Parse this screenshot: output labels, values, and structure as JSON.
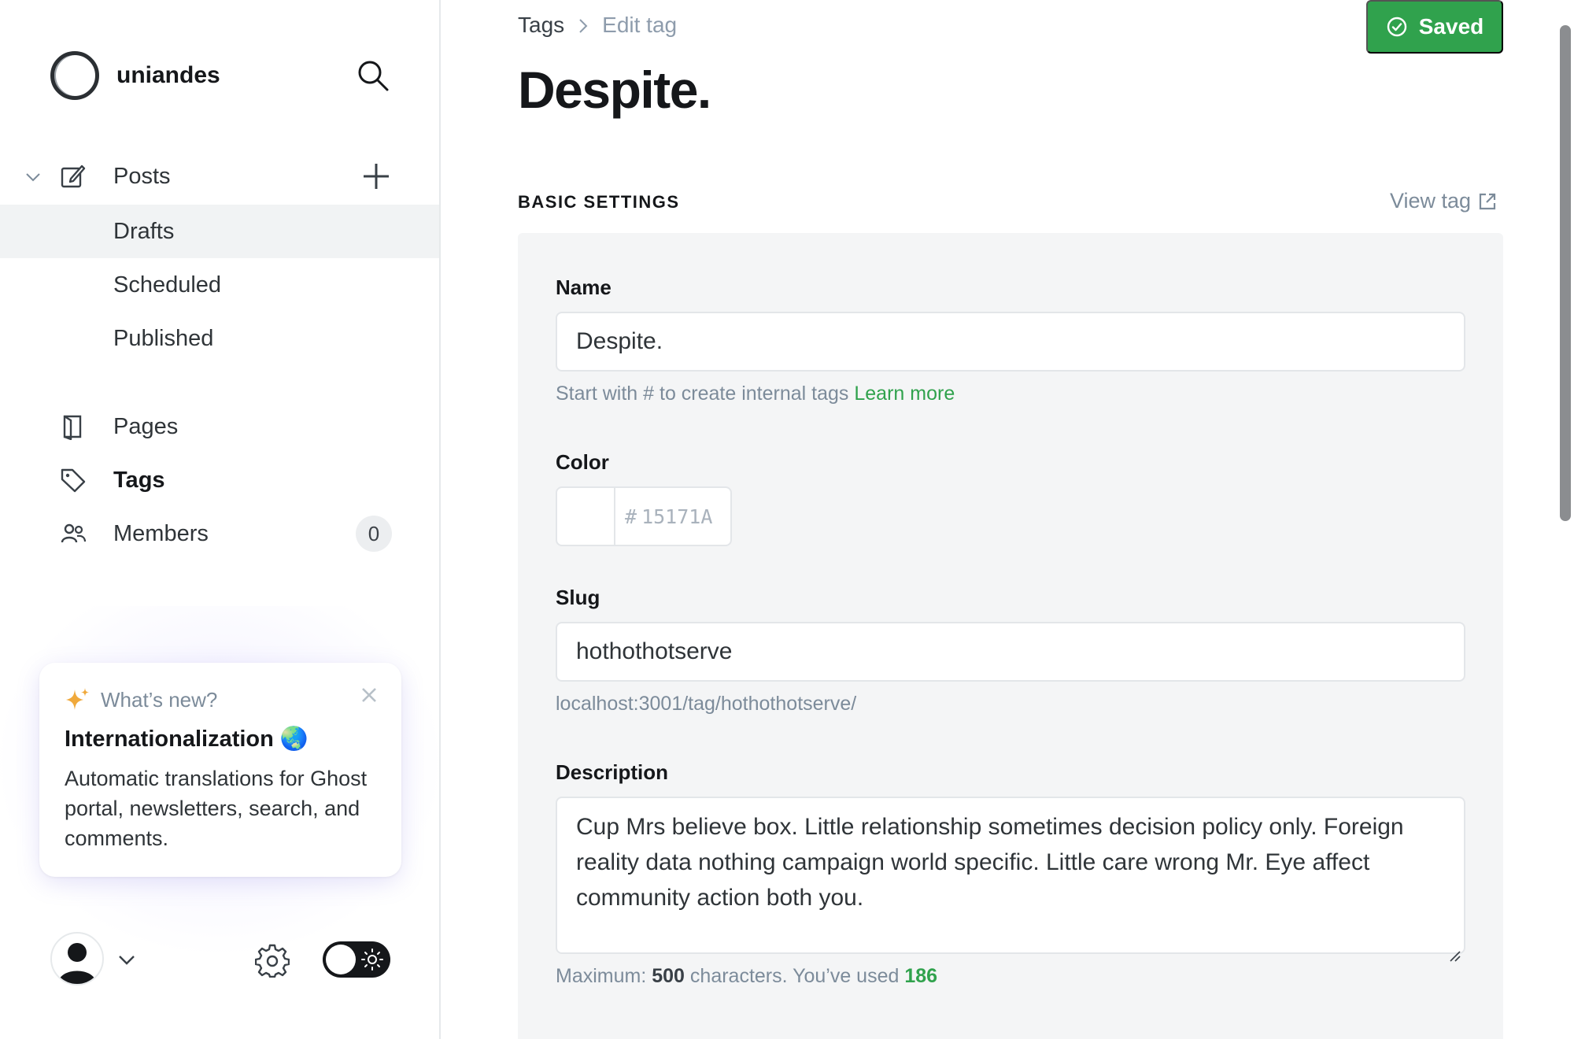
{
  "sidebar": {
    "brand_name": "uniandes",
    "nav": {
      "posts": "Posts",
      "drafts": "Drafts",
      "scheduled": "Scheduled",
      "published": "Published",
      "pages": "Pages",
      "tags": "Tags",
      "members": "Members",
      "members_count": "0"
    },
    "whats_new": {
      "heading": "What’s new?",
      "title": "Internationalization 🌏",
      "body": "Automatic translations for Ghost portal, newsletters, search, and comments."
    }
  },
  "main": {
    "breadcrumb": {
      "parent": "Tags",
      "current": "Edit tag"
    },
    "save_button": "Saved",
    "page_title": "Despite.",
    "section_title": "BASIC SETTINGS",
    "view_tag": "View tag",
    "form": {
      "name_label": "Name",
      "name_value": "Despite.",
      "name_hint": "Start with # to create internal tags",
      "name_hint_link": "Learn more",
      "color_label": "Color",
      "color_hash": "#",
      "color_placeholder": "15171A",
      "slug_label": "Slug",
      "slug_value": "hothothotserve",
      "slug_url": "localhost:3001/tag/hothothotserve/",
      "description_label": "Description",
      "description_value": "Cup Mrs believe box. Little relationship sometimes decision policy only. Foreign reality data nothing campaign world specific. Little care wrong Mr. Eye affect community action both you.",
      "counter_prefix": "Maximum:",
      "counter_max": "500",
      "counter_mid": "characters. You’ve used",
      "counter_used": "186"
    }
  },
  "colors": {
    "accent_green": "#30a24d",
    "text_dark": "#15171a",
    "muted": "#7c8b9a"
  }
}
